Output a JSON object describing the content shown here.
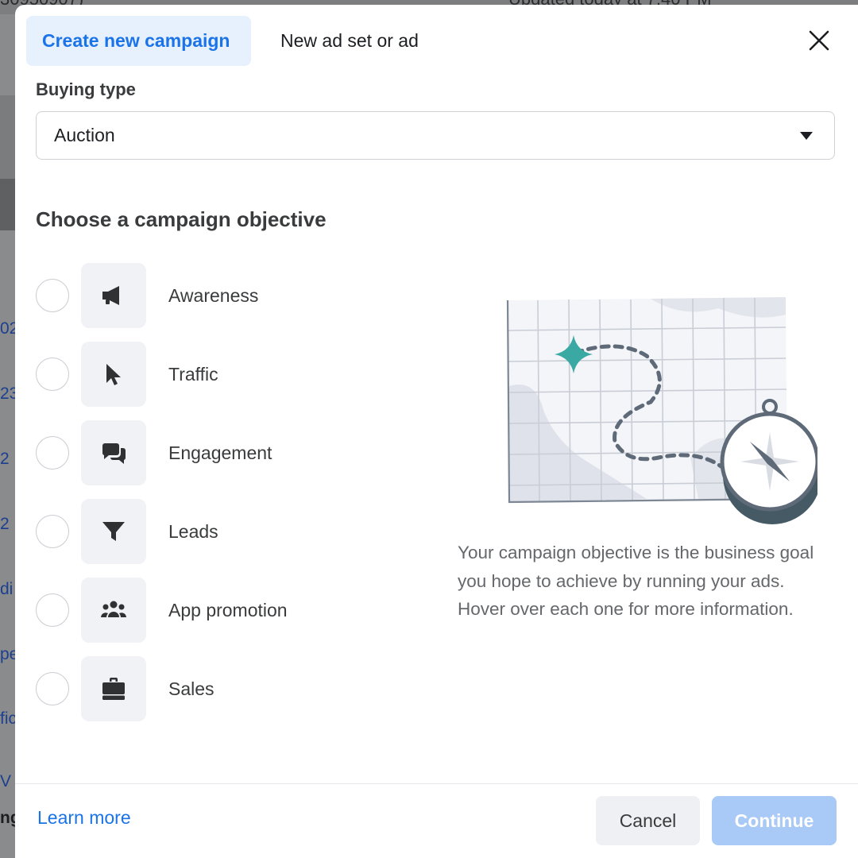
{
  "background": {
    "top_left_text": "30950907)",
    "top_right_text": "Updated today at 7:40 PM",
    "strip": [
      "02",
      "23",
      "2",
      "2",
      "di",
      "pe",
      "fic",
      "V",
      "ng"
    ]
  },
  "tabs": {
    "create_new_campaign": "Create new campaign",
    "new_ad_set_or_ad": "New ad set or ad"
  },
  "buying_type": {
    "label": "Buying type",
    "value": "Auction"
  },
  "objective_section": {
    "title": "Choose a campaign objective",
    "items": [
      {
        "label": "Awareness",
        "icon": "megaphone-icon"
      },
      {
        "label": "Traffic",
        "icon": "cursor-icon"
      },
      {
        "label": "Engagement",
        "icon": "chat-bubbles-icon"
      },
      {
        "label": "Leads",
        "icon": "funnel-icon"
      },
      {
        "label": "App promotion",
        "icon": "people-icon"
      },
      {
        "label": "Sales",
        "icon": "briefcase-icon"
      }
    ],
    "help_text": "Your campaign objective is the business goal you hope to achieve by running your ads. Hover over each one for more information."
  },
  "footer": {
    "learn_more": "Learn more",
    "cancel": "Cancel",
    "continue": "Continue"
  },
  "colors": {
    "accent": "#1a73e8",
    "accent_light": "#e7f0fd",
    "continue_disabled": "#a9c9f7",
    "map_star": "#3aa8a3",
    "compass_dark": "#455a64"
  }
}
